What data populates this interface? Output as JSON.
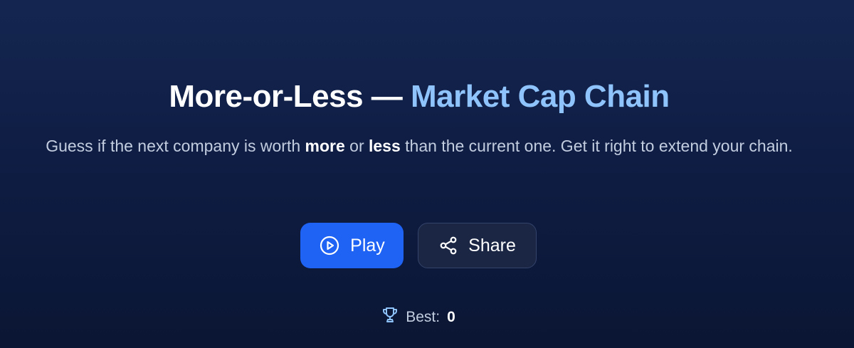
{
  "hero": {
    "title_main": "More-or-Less —",
    "title_accent": "Market Cap Chain",
    "subtitle_parts": {
      "prefix": "Guess if the next company is worth",
      "more": "more",
      "or": "or",
      "less": "less",
      "suffix": "than the current one. Get it right to extend your chain."
    }
  },
  "actions": {
    "play_label": "Play",
    "share_label": "Share"
  },
  "best": {
    "label": "Best:",
    "value": "0"
  },
  "icons": {
    "play": "play-circle-icon",
    "share": "share-icon",
    "trophy": "trophy-icon"
  },
  "colors": {
    "accent": "#8fc3fb",
    "primary_button": "#1f63f4",
    "secondary_button": "#1a2644",
    "background": "#0f1d44"
  }
}
